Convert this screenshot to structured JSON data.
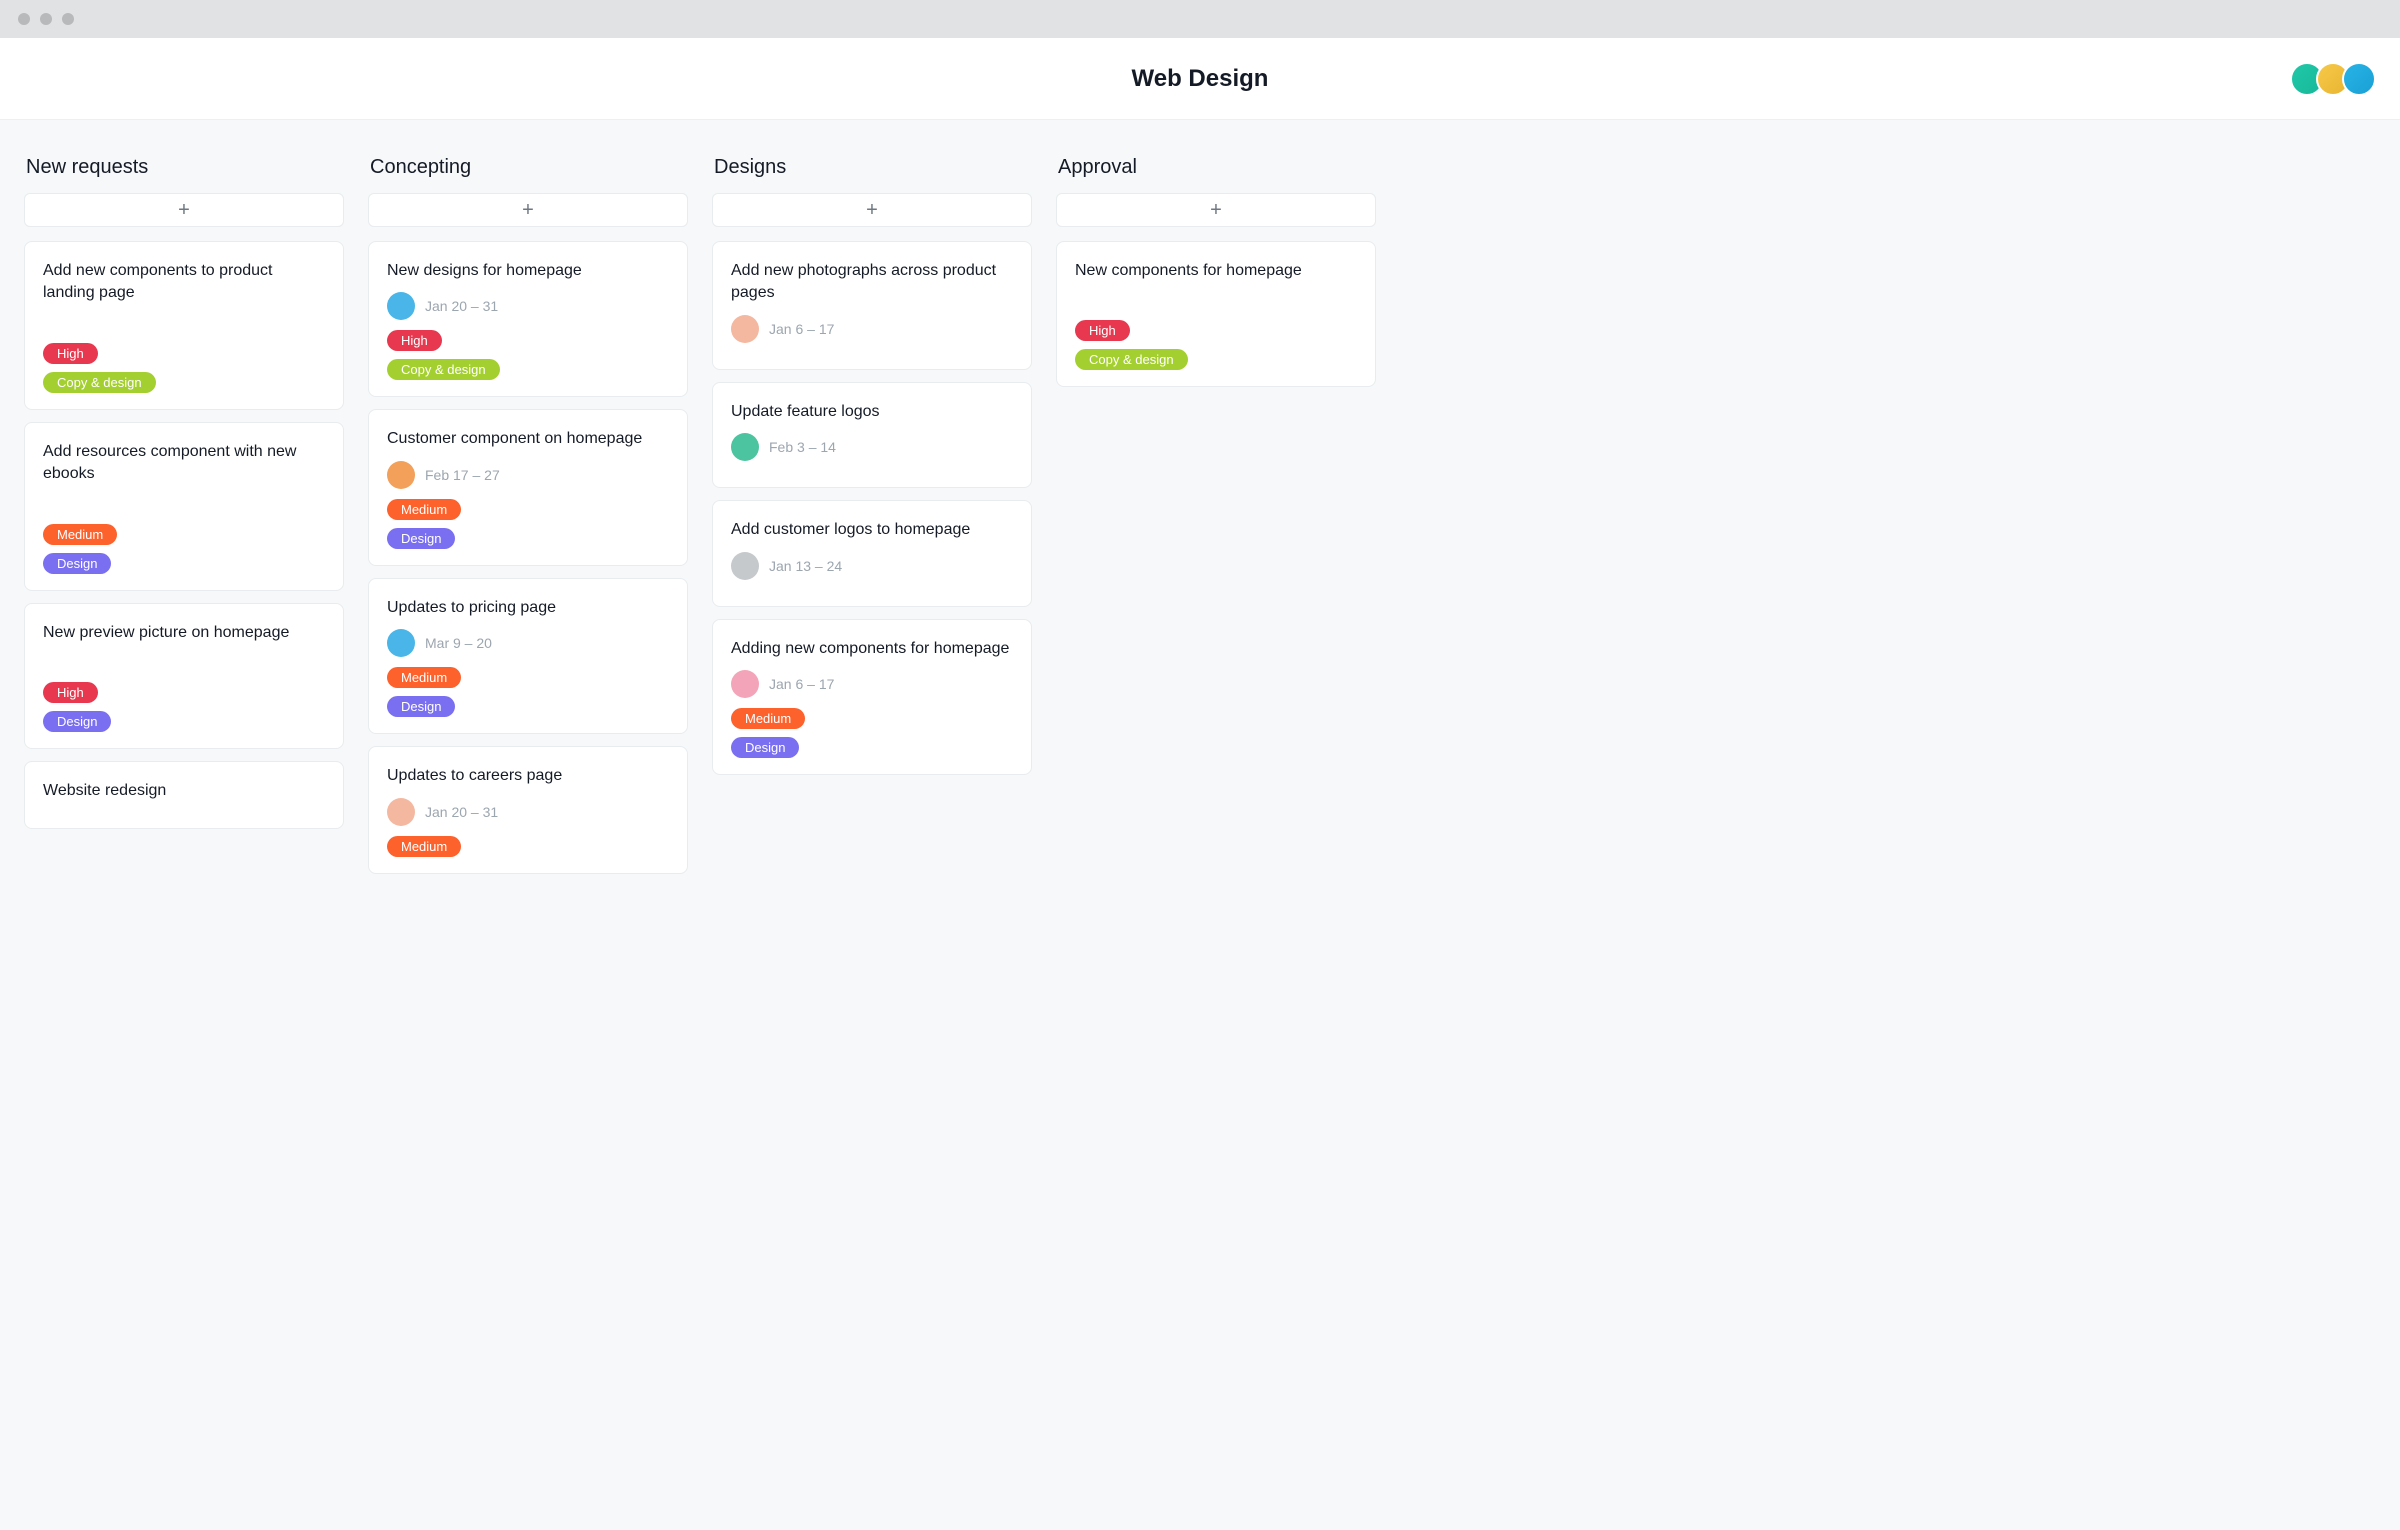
{
  "page_title": "Web Design",
  "columns": [
    {
      "title": "New requests",
      "cards": [
        {
          "title": "Add new components to product landing page",
          "assignee": null,
          "date": null,
          "spacer": true,
          "tags": [
            {
              "label": "High",
              "class": "high"
            },
            {
              "label": "Copy & design",
              "class": "copydesign"
            }
          ]
        },
        {
          "title": "Add resources component with new ebooks",
          "assignee": null,
          "date": null,
          "spacer": true,
          "tags": [
            {
              "label": "Medium",
              "class": "medium"
            },
            {
              "label": "Design",
              "class": "design"
            }
          ]
        },
        {
          "title": "New preview picture on homepage",
          "assignee": null,
          "date": null,
          "spacer": true,
          "tags": [
            {
              "label": "High",
              "class": "high"
            },
            {
              "label": "Design",
              "class": "design"
            }
          ]
        },
        {
          "title": "Website redesign",
          "assignee": null,
          "date": null,
          "spacer": false,
          "tags": []
        }
      ]
    },
    {
      "title": "Concepting",
      "cards": [
        {
          "title": "New designs for homepage",
          "assignee": {
            "class": "asg-blue"
          },
          "date": "Jan 20 – 31",
          "spacer": false,
          "tags": [
            {
              "label": "High",
              "class": "high"
            },
            {
              "label": "Copy & design",
              "class": "copydesign"
            }
          ]
        },
        {
          "title": "Customer component on homepage",
          "assignee": {
            "class": "asg-orange"
          },
          "date": "Feb 17 – 27",
          "spacer": false,
          "tags": [
            {
              "label": "Medium",
              "class": "medium"
            },
            {
              "label": "Design",
              "class": "design"
            }
          ]
        },
        {
          "title": "Updates to pricing page",
          "assignee": {
            "class": "asg-blue"
          },
          "date": "Mar 9 – 20",
          "spacer": false,
          "tags": [
            {
              "label": "Medium",
              "class": "medium"
            },
            {
              "label": "Design",
              "class": "design"
            }
          ]
        },
        {
          "title": "Updates to careers page",
          "assignee": {
            "class": "asg-peach"
          },
          "date": "Jan 20 – 31",
          "spacer": false,
          "tags": [
            {
              "label": "Medium",
              "class": "medium"
            }
          ]
        }
      ]
    },
    {
      "title": "Designs",
      "cards": [
        {
          "title": "Add new photographs across product pages",
          "assignee": {
            "class": "asg-peach"
          },
          "date": "Jan 6 – 17",
          "spacer": false,
          "tags": []
        },
        {
          "title": "Update feature logos",
          "assignee": {
            "class": "asg-green"
          },
          "date": "Feb 3 – 14",
          "spacer": false,
          "tags": []
        },
        {
          "title": "Add customer logos to homepage",
          "assignee": {
            "class": "asg-gray"
          },
          "date": "Jan 13 – 24",
          "spacer": false,
          "tags": []
        },
        {
          "title": "Adding new components for homepage",
          "assignee": {
            "class": "asg-pink"
          },
          "date": "Jan 6 – 17",
          "spacer": false,
          "tags": [
            {
              "label": "Medium",
              "class": "medium"
            },
            {
              "label": "Design",
              "class": "design"
            }
          ]
        }
      ]
    },
    {
      "title": "Approval",
      "cards": [
        {
          "title": "New components for homepage",
          "assignee": null,
          "date": null,
          "spacer": true,
          "tags": [
            {
              "label": "High",
              "class": "high"
            },
            {
              "label": "Copy & design",
              "class": "copydesign"
            }
          ]
        }
      ]
    }
  ]
}
